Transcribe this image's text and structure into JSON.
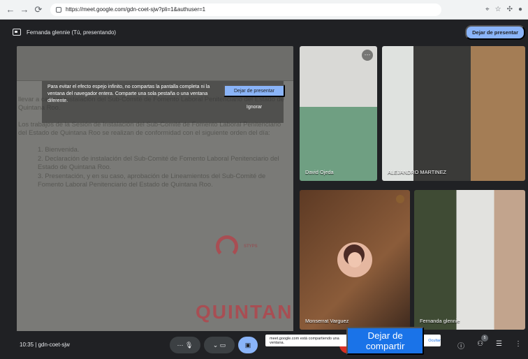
{
  "browser": {
    "url": "https://meet.google.com/gdn-coet-sjw?pli=1&authuser=1"
  },
  "meet": {
    "presenter": "Fernanda glennie (Tú, presentando)",
    "stop_presenting_top": "Dejar de presentar",
    "time": "10:35",
    "meeting_code": "gdn-coet-sjw"
  },
  "shared_screen": {
    "warning": "Para evitar el efecto espejo infinito, no compartas la pantalla completa ni la ventana del navegador entera. Comparte una sola pestaña o una ventana diferente.",
    "stop_presenting": "Dejar de presentar",
    "ignore": "Ignorar",
    "paragraph_1": "llevar a cabo la Instalación del Sub-Comité de Fomento Laboral Penitenciario del Estado de Quintana Roo.",
    "paragraph_2": "Los trabajos de la Sesión de Instalación del Sub-Comité de Fomento Laboral Penitenciario del Estado de Quintana Roo se realizan de conformidad con el siguiente orden del día:",
    "agenda": [
      "1. Bienvenida.",
      "2. Declaración de instalación del Sub-Comité de Fomento Laboral Penitenciario del Estado de Quintana Roo.",
      "3. Presentación, y en su caso, aprobación de Lineamientos del Sub-Comité de Fomento Laboral Penitenciario del Estado de Quintana Roo."
    ],
    "logo_1": "STYPS",
    "logo_2": "QUINTANA"
  },
  "participants": {
    "p1": "David Ojeda",
    "p2": "ALEJANDRO MARTINEZ",
    "p3": "Monserrat Varguez",
    "p4": "Fernanda glennie"
  },
  "sharing_banner": {
    "message": "meet.google.com está compartiendo una ventana.",
    "stop": "Dejar de compartir",
    "hide": "Ocultar"
  },
  "controls": {
    "participant_count": "5"
  }
}
